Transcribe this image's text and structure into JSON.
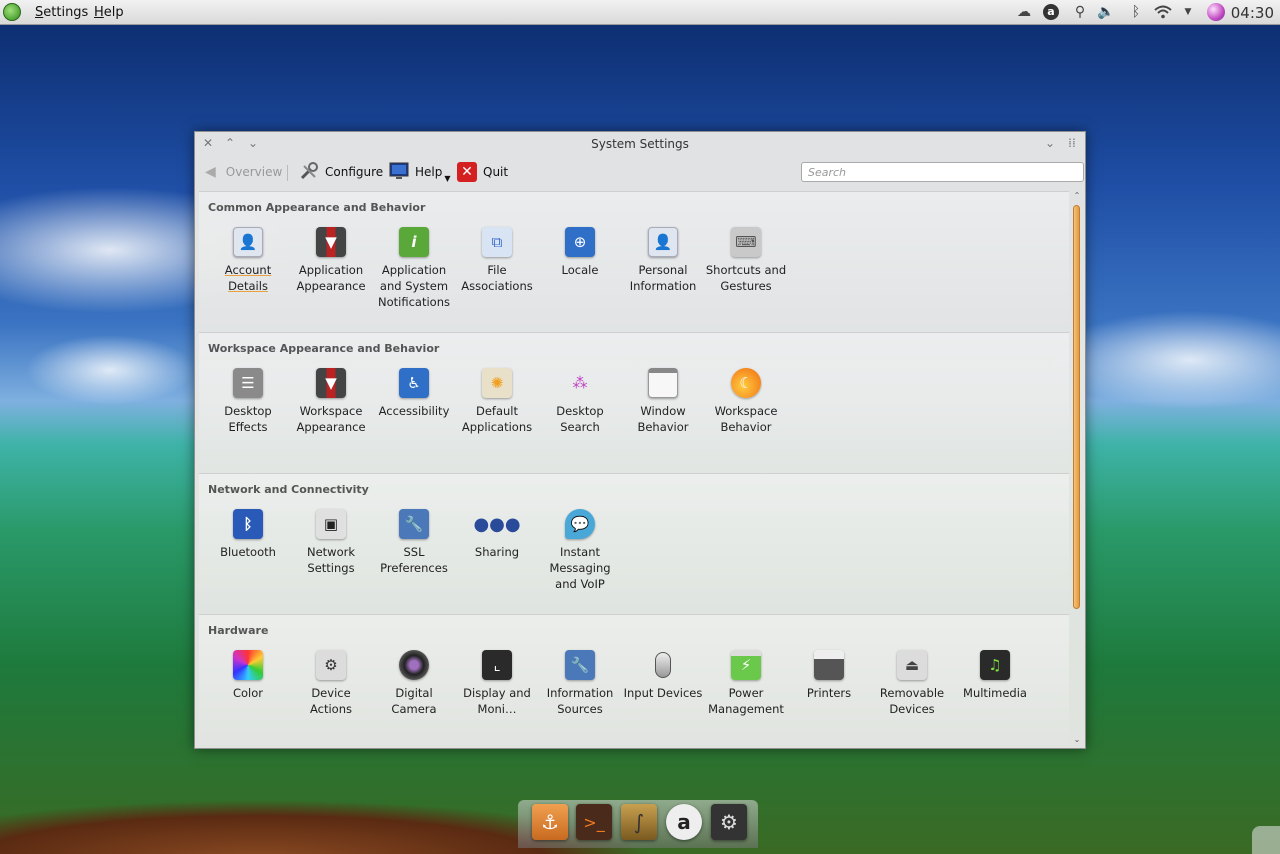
{
  "panel": {
    "menus": [
      "Settings",
      "Help"
    ],
    "clock": "04:30"
  },
  "window": {
    "title": "System Settings",
    "toolbar": {
      "overview": "Overview",
      "configure": "Configure",
      "help": "Help",
      "quit": "Quit",
      "search_placeholder": "Search"
    },
    "sections": [
      {
        "title": "Common Appearance and Behavior",
        "items": [
          {
            "label": "Account Details",
            "icon": "account-details-icon",
            "color": "#dfe6ef"
          },
          {
            "label": "Application Appearance",
            "icon": "application-appearance-icon",
            "color": "#8b2a2a"
          },
          {
            "label": "Application and System Notifications",
            "icon": "notifications-icon",
            "color": "#5aa83a"
          },
          {
            "label": "File Associations",
            "icon": "file-associations-icon",
            "color": "#d8e4f4"
          },
          {
            "label": "Locale",
            "icon": "locale-globe-icon",
            "color": "#2f6fc8"
          },
          {
            "label": "Personal Information",
            "icon": "personal-information-icon",
            "color": "#dfe6ef"
          },
          {
            "label": "Shortcuts and Gestures",
            "icon": "keyboard-icon",
            "color": "#c9c9c9"
          }
        ]
      },
      {
        "title": "Workspace Appearance and Behavior",
        "items": [
          {
            "label": "Desktop Effects",
            "icon": "desktop-effects-icon",
            "color": "#8a8a8a"
          },
          {
            "label": "Workspace Appearance",
            "icon": "workspace-appearance-icon",
            "color": "#8b2a2a"
          },
          {
            "label": "Accessibility",
            "icon": "accessibility-icon",
            "color": "#2f6fc8"
          },
          {
            "label": "Default Applications",
            "icon": "default-applications-icon",
            "color": "#f0c040"
          },
          {
            "label": "Desktop Search",
            "icon": "desktop-search-icon",
            "color": "#e8e8e8"
          },
          {
            "label": "Window Behavior",
            "icon": "window-behavior-icon",
            "color": "#f4f4f4"
          },
          {
            "label": "Workspace Behavior",
            "icon": "workspace-behavior-icon",
            "color": "#f08a20"
          }
        ]
      },
      {
        "title": "Network and Connectivity",
        "items": [
          {
            "label": "Bluetooth",
            "icon": "bluetooth-icon",
            "color": "#2a5ab8"
          },
          {
            "label": "Network Settings",
            "icon": "network-settings-icon",
            "color": "#e0e0e0"
          },
          {
            "label": "SSL Preferences",
            "icon": "ssl-preferences-icon",
            "color": "#4a78b8"
          },
          {
            "label": "Sharing",
            "icon": "sharing-icon",
            "color": "#e8e8e8"
          },
          {
            "label": "Instant Messaging and VoIP",
            "icon": "instant-messaging-icon",
            "color": "#4aa8d8"
          }
        ]
      },
      {
        "title": "Hardware",
        "items": [
          {
            "label": "Color",
            "icon": "color-icon",
            "color": "#e84a8a"
          },
          {
            "label": "Device Actions",
            "icon": "device-actions-icon",
            "color": "#dcdcdc"
          },
          {
            "label": "Digital Camera",
            "icon": "digital-camera-icon",
            "color": "#3a3a3a"
          },
          {
            "label": "Display and Moni…",
            "icon": "display-monitor-icon",
            "color": "#2a2a2a"
          },
          {
            "label": "Information Sources",
            "icon": "information-sources-icon",
            "color": "#4a78b8"
          },
          {
            "label": "Input Devices",
            "icon": "input-devices-icon",
            "color": "#d8d8d8"
          },
          {
            "label": "Power Management",
            "icon": "power-management-icon",
            "color": "#6ac84a"
          },
          {
            "label": "Printers",
            "icon": "printers-icon",
            "color": "#5a5a5a"
          },
          {
            "label": "Removable Devices",
            "icon": "removable-devices-icon",
            "color": "#dcdcdc"
          },
          {
            "label": "Multimedia",
            "icon": "multimedia-icon",
            "color": "#2a2a2a"
          }
        ]
      }
    ]
  },
  "dock": [
    "anchor-icon",
    "terminal-icon",
    "curve-app-icon",
    "amazon-icon",
    "settings-app-icon"
  ]
}
